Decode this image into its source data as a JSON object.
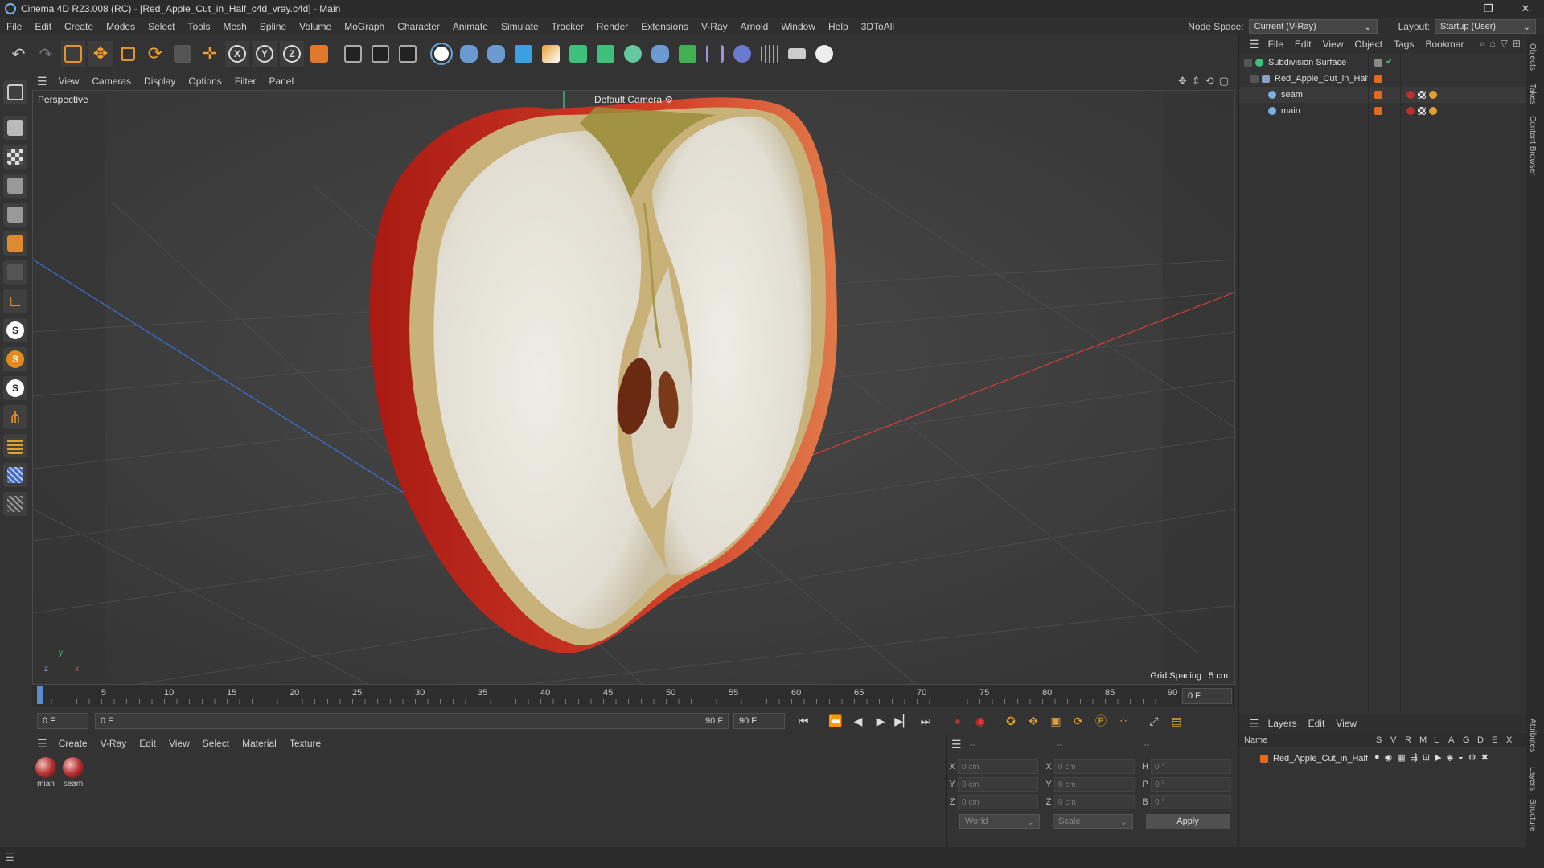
{
  "window": {
    "title": "Cinema 4D R23.008 (RC) - [Red_Apple_Cut_in_Half_c4d_vray.c4d] - Main"
  },
  "menubar": {
    "items": [
      "File",
      "Edit",
      "Create",
      "Modes",
      "Select",
      "Tools",
      "Mesh",
      "Spline",
      "Volume",
      "MoGraph",
      "Character",
      "Animate",
      "Simulate",
      "Tracker",
      "Render",
      "Extensions",
      "V-Ray",
      "Arnold",
      "Window",
      "Help",
      "3DToAll"
    ],
    "node_space_label": "Node Space:",
    "node_space_value": "Current (V-Ray)",
    "layout_label": "Layout:",
    "layout_value": "Startup (User)"
  },
  "viewport": {
    "menu": [
      "View",
      "Cameras",
      "Display",
      "Options",
      "Filter",
      "Panel"
    ],
    "label": "Perspective",
    "camera": "Default Camera",
    "grid_spacing": "Grid Spacing : 5 cm"
  },
  "timeline": {
    "ticks": [
      "0",
      "5",
      "10",
      "15",
      "20",
      "25",
      "30",
      "35",
      "40",
      "45",
      "50",
      "55",
      "60",
      "65",
      "70",
      "75",
      "80",
      "85",
      "90"
    ],
    "end_field": "0 F"
  },
  "transport": {
    "current_frame": "0 F",
    "range_start": "0 F",
    "range_end": "90 F",
    "max_frame": "90 F"
  },
  "material_panel": {
    "menu": [
      "Create",
      "V-Ray",
      "Edit",
      "View",
      "Select",
      "Material",
      "Texture"
    ],
    "materials": [
      "mian",
      "seam"
    ]
  },
  "coordinates": {
    "header_dashes": [
      "--",
      "--",
      "--"
    ],
    "rows": [
      {
        "a": "X",
        "av": "0 cm",
        "b": "X",
        "bv": "0 cm",
        "c": "H",
        "cv": "0 °"
      },
      {
        "a": "Y",
        "av": "0 cm",
        "b": "Y",
        "bv": "0 cm",
        "c": "P",
        "cv": "0 °"
      },
      {
        "a": "Z",
        "av": "0 cm",
        "b": "Z",
        "bv": "0 cm",
        "c": "B",
        "cv": "0 °"
      }
    ],
    "space": "World",
    "mode": "Scale",
    "apply": "Apply"
  },
  "object_manager": {
    "menu": [
      "File",
      "Edit",
      "View",
      "Object",
      "Tags",
      "Bookmar"
    ],
    "objects": [
      {
        "name": "Subdivision Surface"
      },
      {
        "name": "Red_Apple_Cut_in_Half"
      },
      {
        "name": "seam"
      },
      {
        "name": "main"
      }
    ]
  },
  "layers": {
    "menu": [
      "Layers",
      "Edit",
      "View"
    ],
    "columns": [
      "Name",
      "S",
      "V",
      "R",
      "M",
      "L",
      "A",
      "G",
      "D",
      "E",
      "X"
    ],
    "rows": [
      {
        "name": "Red_Apple_Cut_in_Half"
      }
    ]
  },
  "side_tabs": [
    "Objects",
    "Takes",
    "Content Browser",
    "Attributes",
    "Layers",
    "Structure"
  ],
  "colors": {
    "accent": "#e06a20",
    "axis_x": "#d23c3c",
    "axis_z": "#3c6ed2",
    "apple_red": "#c8281e",
    "flesh": "#e8e6df"
  }
}
